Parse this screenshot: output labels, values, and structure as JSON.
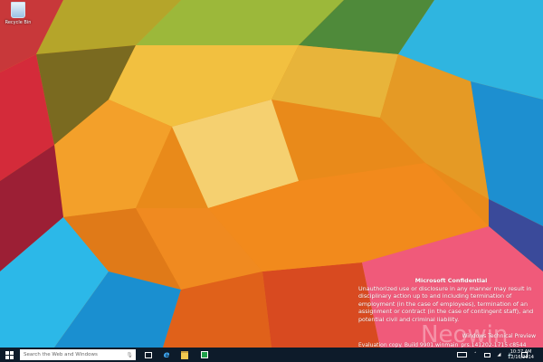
{
  "desktop": {
    "icons": [
      {
        "label": "Recycle Bin",
        "icon": "recycle-bin-icon"
      }
    ],
    "watermark": {
      "title": "Microsoft Confidential",
      "body": "Unauthorized use or disclosure in any manner may result in disciplinary action up to and including termination of employment (in the case of employees), termination of an assignment or contract (in the case of contingent staff), and potential civil and criminal liability.",
      "edition": "Windows Technical Preview",
      "build": "Evaluation copy. Build 9901.winmain_prs.141202-1715 c8544",
      "logo": "Neowin"
    }
  },
  "taskbar": {
    "search_placeholder": "Search the Web and Windows",
    "apps": [
      "task-view-icon",
      "internet-explorer-icon",
      "file-explorer-icon",
      "store-icon"
    ],
    "tray": [
      "keyboard-icon",
      "show-hidden-icons",
      "battery-icon",
      "network-icon",
      "volume-icon",
      "action-center-icon"
    ],
    "time": "10:37 AM",
    "date": "12/16/2014"
  }
}
